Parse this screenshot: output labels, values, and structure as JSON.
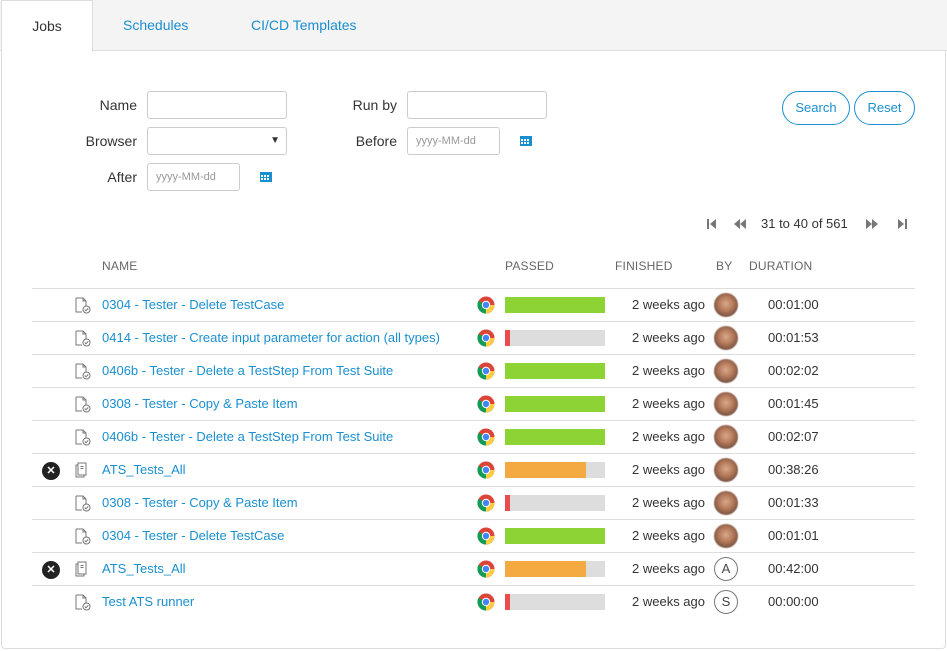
{
  "tabs": [
    {
      "label": "Jobs",
      "active": true
    },
    {
      "label": "Schedules",
      "active": false
    },
    {
      "label": "CI/CD Templates",
      "active": false
    }
  ],
  "filters": {
    "name_label": "Name",
    "name_value": "",
    "runby_label": "Run by",
    "runby_value": "",
    "browser_label": "Browser",
    "browser_value": "",
    "before_label": "Before",
    "before_placeholder": "yyyy-MM-dd",
    "after_label": "After",
    "after_placeholder": "yyyy-MM-dd",
    "search_label": "Search",
    "reset_label": "Reset"
  },
  "pagination": {
    "text": "31 to 40 of 561",
    "icons": [
      "first-page-icon",
      "prev-page-icon",
      "next-page-icon",
      "last-page-icon"
    ]
  },
  "table": {
    "columns": [
      "NAME",
      "PASSED",
      "FINISHED",
      "BY",
      "DURATION"
    ],
    "rows": [
      {
        "status": "",
        "name": "0304 - Tester - Delete TestCase",
        "passed": 1.0,
        "bar_color": "#8ed334",
        "finished": "2 weeks ago",
        "by": "photo",
        "duration": "00:01:00"
      },
      {
        "status": "",
        "name": "0414 - Tester - Create input parameter for action (all types)",
        "passed": 0.05,
        "bar_color": "#e84c4c",
        "finished": "2 weeks ago",
        "by": "photo",
        "duration": "00:01:53"
      },
      {
        "status": "",
        "name": "0406b - Tester - Delete a TestStep From Test Suite",
        "passed": 1.0,
        "bar_color": "#8ed334",
        "finished": "2 weeks ago",
        "by": "photo",
        "duration": "00:02:02"
      },
      {
        "status": "",
        "name": "0308 - Tester - Copy & Paste Item",
        "passed": 1.0,
        "bar_color": "#8ed334",
        "finished": "2 weeks ago",
        "by": "photo",
        "duration": "00:01:45"
      },
      {
        "status": "",
        "name": "0406b - Tester - Delete a TestStep From Test Suite",
        "passed": 1.0,
        "bar_color": "#8ed334",
        "finished": "2 weeks ago",
        "by": "photo",
        "duration": "00:02:07"
      },
      {
        "status": "error",
        "name": "ATS_Tests_All",
        "passed": 0.81,
        "bar_color": "#f5a941",
        "finished": "2 weeks ago",
        "by": "photo",
        "duration": "00:38:26"
      },
      {
        "status": "",
        "name": "0308 - Tester - Copy & Paste Item",
        "passed": 0.05,
        "bar_color": "#e84c4c",
        "finished": "2 weeks ago",
        "by": "photo",
        "duration": "00:01:33"
      },
      {
        "status": "",
        "name": "0304 - Tester - Delete TestCase",
        "passed": 1.0,
        "bar_color": "#8ed334",
        "finished": "2 weeks ago",
        "by": "photo",
        "duration": "00:01:01"
      },
      {
        "status": "error",
        "name": "ATS_Tests_All",
        "passed": 0.81,
        "bar_color": "#f5a941",
        "finished": "2 weeks ago",
        "by": "A",
        "duration": "00:42:00"
      },
      {
        "status": "",
        "name": "Test ATS runner",
        "passed": 0.05,
        "bar_color": "#e84c4c",
        "finished": "2 weeks ago",
        "by": "S",
        "duration": "00:00:00"
      }
    ]
  }
}
